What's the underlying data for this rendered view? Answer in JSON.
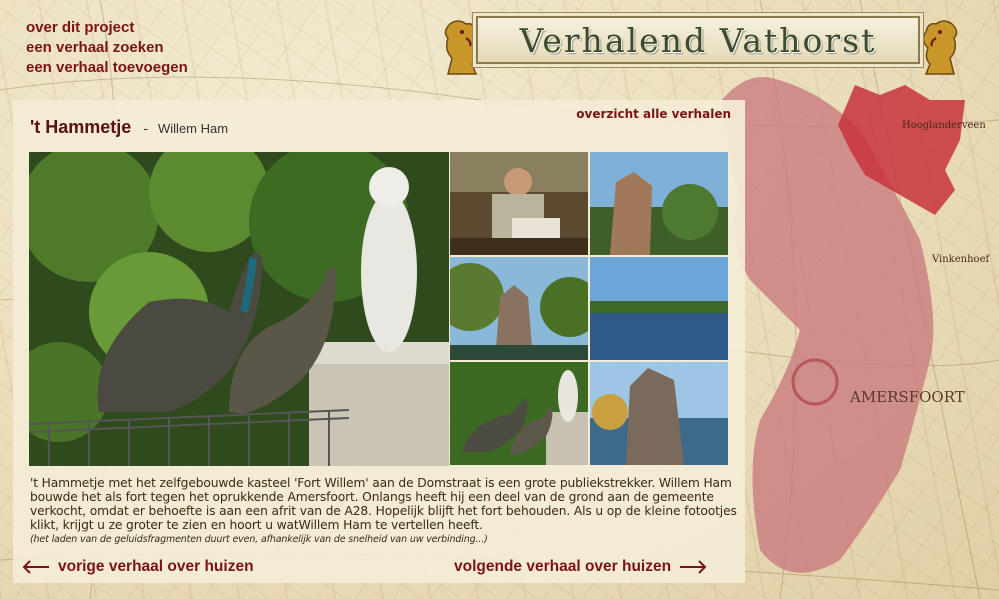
{
  "nav": {
    "about": "over dit project",
    "find": "een verhaal zoeken",
    "add": "een verhaal toevoegen"
  },
  "banner": {
    "title": "Verhalend Vathorst"
  },
  "story": {
    "title": "'t Hammetje",
    "separator": "-",
    "author": "Willem Ham",
    "overview_link": "overzicht alle verhalen",
    "text": "'t Hammetje met het zelfgebouwde kasteel 'Fort Willem' aan de Domstraat is een grote publiekstrekker. Willem Ham bouwde het als fort tegen het oprukkende Amersfoort. Onlangs heeft hij een deel van de grond aan de gemeente verkocht, omdat er behoefte is aan een afrit van de A28. Hopelijk blijft het fort behouden. Als u op de kleine fotootjes klikt, krijgt u ze groter te zien en hoort u watWillem Ham te vertellen heeft.",
    "note": "(het laden van de geluidsfragmenten duurt even, afhankelijk van de snelheid van uw verbinding...)"
  },
  "pager": {
    "prev": "vorige verhaal over huizen",
    "next": "volgende verhaal over huizen"
  },
  "map_labels": {
    "hooglanderveen": "Hooglanderveen",
    "vinkenhoef": "Vinkenhoef",
    "amersfoort": "AMERSFOORT"
  },
  "colors": {
    "accent": "#7a1414",
    "region_pink": "#c9787f",
    "region_red": "#c8323c"
  }
}
